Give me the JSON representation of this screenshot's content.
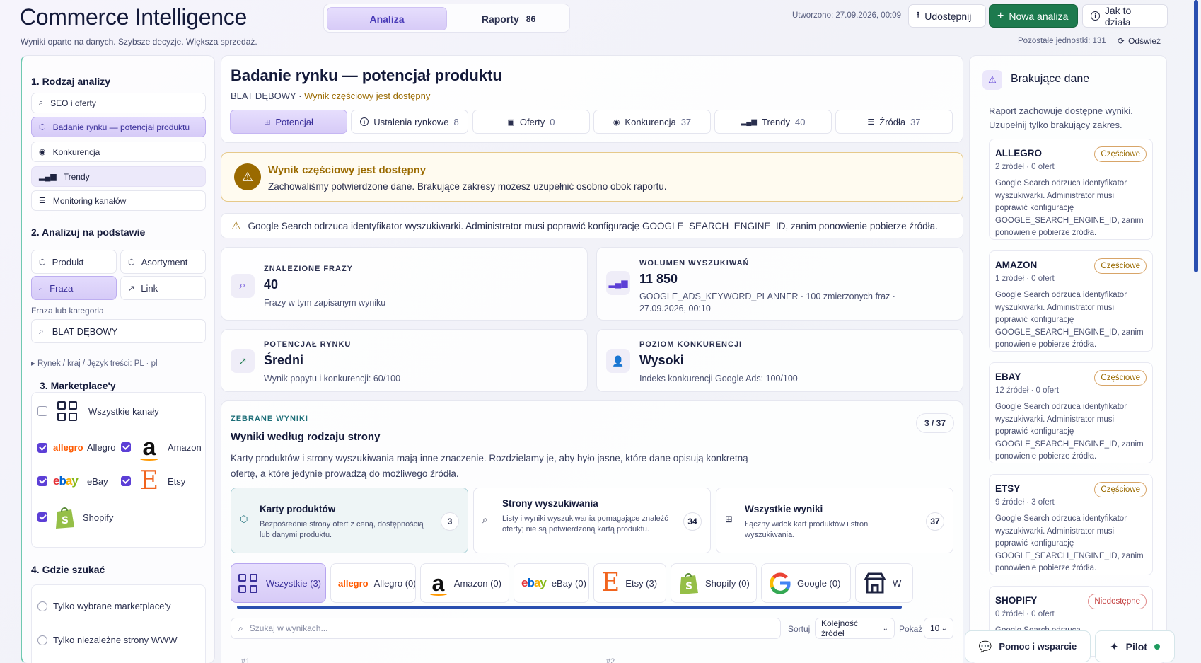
{
  "header": {
    "title": "Commerce Intelligence",
    "subtitle": "Wyniki oparte na danych. Szybsze decyzje. Większa sprzedaż.",
    "tabs": [
      {
        "label": "Analiza",
        "count": ""
      },
      {
        "label": "Raporty",
        "count": "86"
      }
    ],
    "created": "Utworzono: 27.09.2026, 00:09",
    "share_label": "Udostępnij",
    "new_label": "Nowa analiza",
    "how_label": "Jak to działa",
    "remaining": "Pozostałe jednostki: 131",
    "refresh_label": "Odśwież"
  },
  "left": {
    "s1_title": "1. Rodzaj analizy",
    "analysis_types": [
      "SEO i oferty",
      "Badanie rynku — potencjał produktu",
      "Konkurencja",
      "Trendy",
      "Monitoring kanałów"
    ],
    "s2_title": "2. Analizuj na podstawie",
    "basis": [
      "Produkt",
      "Asortyment",
      "Fraza",
      "Link"
    ],
    "field_label": "Fraza lub kategoria",
    "field_value": "BLAT DĘBOWY",
    "market_hint": "▸ Rynek / kraj / Język treści: PL · pl",
    "s3_title": "3. Marketplace'y",
    "all_channels": "Wszystkie kanały",
    "marketplaces": [
      "Allegro",
      "Amazon",
      "eBay",
      "Etsy",
      "Shopify"
    ],
    "s4_title": "4. Gdzie szukać",
    "where": [
      "Tylko wybrane marketplace'y",
      "Tylko niezależne strony WWW"
    ]
  },
  "main": {
    "title": "Badanie rynku — potencjał produktu",
    "sub_phrase": "BLAT DĘBOWY · ",
    "sub_warn": "Wynik częściowy jest dostępny",
    "tabs": [
      {
        "label": "Potencjał",
        "count": ""
      },
      {
        "label": "Ustalenia rynkowe",
        "count": "8"
      },
      {
        "label": "Oferty",
        "count": "0"
      },
      {
        "label": "Konkurencja",
        "count": "37"
      },
      {
        "label": "Trendy",
        "count": "40"
      },
      {
        "label": "Źródła",
        "count": "37"
      }
    ],
    "alert_title": "Wynik częściowy jest dostępny",
    "alert_text": "Zachowaliśmy potwierdzone dane. Brakujące zakresy możesz uzupełnić osobno obok raportu.",
    "note": "Google Search odrzuca identyfikator wyszukiwarki. Administrator musi poprawić konfigurację GOOGLE_SEARCH_ENGINE_ID, zanim ponowienie pobierze źródła.",
    "stats": [
      {
        "label": "ZNALEZIONE FRAZY",
        "value": "40",
        "desc": "Frazy w tym zapisanym wyniku"
      },
      {
        "label": "WOLUMEN WYSZUKIWAŃ",
        "value": "11 850",
        "desc": "GOOGLE_ADS_KEYWORD_PLANNER · 100 zmierzonych fraz · 27.09.2026, 00:10"
      },
      {
        "label": "POTENCJAŁ RYNKU",
        "value": "Średni",
        "desc": "Wynik popytu i konkurencji: 60/100"
      },
      {
        "label": "POZIOM KONKURENCJI",
        "value": "Wysoki",
        "desc": "Indeks konkurencji Google Ads: 100/100"
      }
    ],
    "results": {
      "kicker": "ZEBRANE WYNIKI",
      "title": "Wyniki według rodzaju strony",
      "desc": "Karty produktów i strony wyszukiwania mają inne znaczenie. Rozdzielamy je, aby było jasne, które dane opisują konkretną ofertę, a które jedynie prowadzą do możliwego źródła.",
      "counter": "3 / 37",
      "types": [
        {
          "title": "Karty produktów",
          "desc": "Bezpośrednie strony ofert z ceną, dostępnością lub danymi produktu.",
          "count": "3"
        },
        {
          "title": "Strony wyszukiwania",
          "desc": "Listy i wyniki wyszukiwania pomagające znaleźć oferty; nie są potwierdzoną kartą produktu.",
          "count": "34"
        },
        {
          "title": "Wszystkie wyniki",
          "desc": "Łączny widok kart produktów i stron wyszukiwania.",
          "count": "37"
        }
      ],
      "chips": [
        "Wszystkie (3)",
        "Allegro (0)",
        "Amazon (0)",
        "eBay (0)",
        "Etsy (3)",
        "Shopify (0)",
        "Google (0)",
        "W"
      ],
      "search_placeholder": "Szukaj w wynikach...",
      "sort_label": "Sortuj",
      "sort_value": "Kolejność źródeł",
      "show_label": "Pokaż",
      "show_value": "10",
      "row1": "#1",
      "row2": "#2"
    }
  },
  "right": {
    "title": "Brakujące dane",
    "desc": "Raport zachowuje dostępne wyniki. Uzupełnij tylko brakujący zakres.",
    "markets": [
      {
        "name": "ALLEGRO",
        "stat": "2 źródeł · 0 ofert",
        "badge": "Częściowe",
        "msg": "Google Search odrzuca identyfikator wyszukiwarki. Administrator musi poprawić konfigurację GOOGLE_SEARCH_ENGINE_ID, zanim ponowienie pobierze źródła."
      },
      {
        "name": "AMAZON",
        "stat": "1 źródeł · 0 ofert",
        "badge": "Częściowe",
        "msg": "Google Search odrzuca identyfikator wyszukiwarki. Administrator musi poprawić konfigurację GOOGLE_SEARCH_ENGINE_ID, zanim ponowienie pobierze źródła."
      },
      {
        "name": "EBAY",
        "stat": "12 źródeł · 0 ofert",
        "badge": "Częściowe",
        "msg": "Google Search odrzuca identyfikator wyszukiwarki. Administrator musi poprawić konfigurację GOOGLE_SEARCH_ENGINE_ID, zanim ponowienie pobierze źródła."
      },
      {
        "name": "ETSY",
        "stat": "9 źródeł · 3 ofert",
        "badge": "Częściowe",
        "msg": "Google Search odrzuca identyfikator wyszukiwarki. Administrator musi poprawić konfigurację GOOGLE_SEARCH_ENGINE_ID, zanim ponowienie pobierze źródła."
      },
      {
        "name": "SHOPIFY",
        "stat": "0 źródeł · 0 ofert",
        "badge": "Niedostępne",
        "msg": "Google Search odrzuca"
      }
    ],
    "help_label": "Pomoc i wsparcie",
    "pilot_label": "Pilot"
  },
  "colors": {
    "accent": "#5c3fd6",
    "primary_green": "#1d7a4e",
    "warning": "#9a6a00",
    "danger": "#c23a3a",
    "teal": "#1d6e78"
  }
}
